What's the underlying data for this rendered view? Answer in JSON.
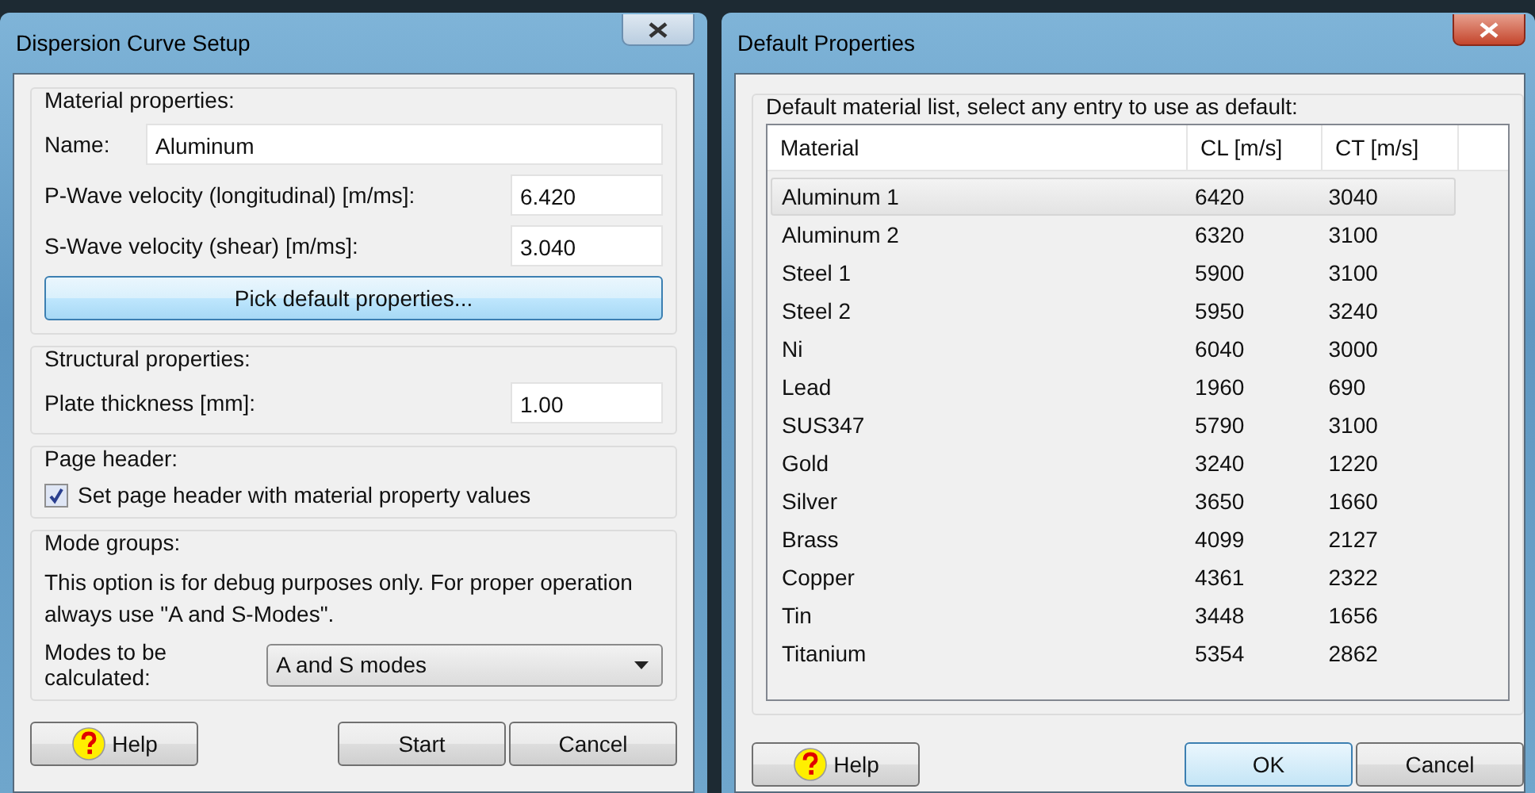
{
  "setup_window": {
    "title": "Dispersion Curve Setup",
    "material": {
      "legend": "Material properties:",
      "name_label": "Name:",
      "name_value": "Aluminum",
      "p_label": "P-Wave velocity (longitudinal) [m/ms]:",
      "p_value": "6.420",
      "s_label": "S-Wave velocity (shear) [m/ms]:",
      "s_value": "3.040",
      "pick_button": "Pick default properties..."
    },
    "structural": {
      "legend": "Structural properties:",
      "thickness_label": "Plate thickness [mm]:",
      "thickness_value": "1.00"
    },
    "page_header": {
      "legend": "Page header:",
      "checkbox_label": "Set page header with material property values",
      "checked": true
    },
    "mode_groups": {
      "legend": "Mode groups:",
      "note": "This option is for debug purposes only. For proper operation always use \"A and S-Modes\".",
      "modes_label": "Modes to be calculated:",
      "modes_value": "A and S modes"
    },
    "buttons": {
      "help": "Help",
      "start": "Start",
      "cancel": "Cancel"
    }
  },
  "defaults_window": {
    "title": "Default Properties",
    "legend": "Default material list, select any entry to use as default:",
    "table": {
      "columns": [
        "Material",
        "CL [m/s]",
        "CT [m/s]"
      ],
      "rows": [
        {
          "cells": [
            "Aluminum 1",
            "6420",
            "3040"
          ],
          "selected": true
        },
        {
          "cells": [
            "Aluminum 2",
            "6320",
            "3100"
          ],
          "selected": false
        },
        {
          "cells": [
            "Steel 1",
            "5900",
            "3100"
          ],
          "selected": false
        },
        {
          "cells": [
            "Steel 2",
            "5950",
            "3240"
          ],
          "selected": false
        },
        {
          "cells": [
            "Ni",
            "6040",
            "3000"
          ],
          "selected": false
        },
        {
          "cells": [
            "Lead",
            "1960",
            "690"
          ],
          "selected": false
        },
        {
          "cells": [
            "SUS347",
            "5790",
            "3100"
          ],
          "selected": false
        },
        {
          "cells": [
            "Gold",
            "3240",
            "1220"
          ],
          "selected": false
        },
        {
          "cells": [
            "Silver",
            "3650",
            "1660"
          ],
          "selected": false
        },
        {
          "cells": [
            "Brass",
            "4099",
            "2127"
          ],
          "selected": false
        },
        {
          "cells": [
            "Copper",
            "4361",
            "2322"
          ],
          "selected": false
        },
        {
          "cells": [
            "Tin",
            "3448",
            "1656"
          ],
          "selected": false
        },
        {
          "cells": [
            "Titanium",
            "5354",
            "2862"
          ],
          "selected": false
        }
      ]
    },
    "buttons": {
      "help": "Help",
      "ok": "OK",
      "cancel": "Cancel"
    }
  }
}
